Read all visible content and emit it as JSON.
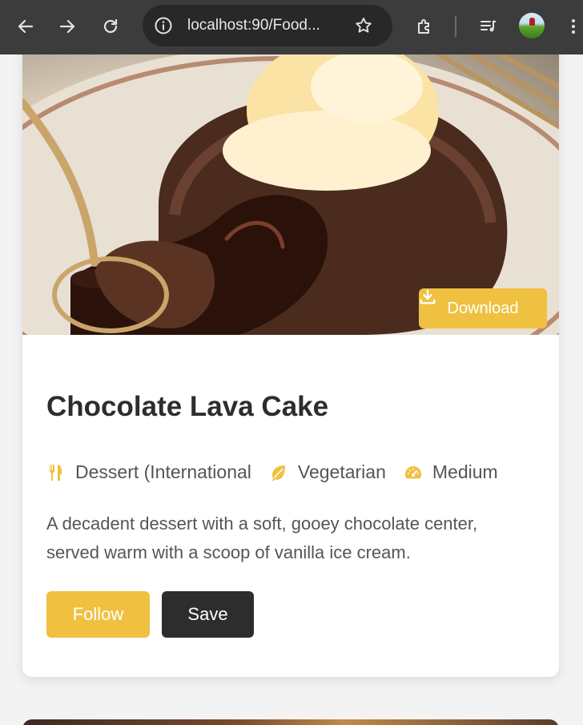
{
  "browser": {
    "url": "localhost:90/Food...",
    "icons": {
      "back": "back-arrow-icon",
      "forward": "forward-arrow-icon",
      "reload": "reload-icon",
      "site_info": "info-icon",
      "bookmark": "star-icon",
      "extensions": "puzzle-icon",
      "media": "media-queue-icon",
      "menu": "kebab-menu-icon"
    }
  },
  "recipe": {
    "download_label": "Download",
    "title": "Chocolate Lava Cake",
    "cuisine": "Dessert (International",
    "diet": "Vegetarian",
    "difficulty": "Medium",
    "description": "A decadent dessert with a soft, gooey chocolate center, served warm with a scoop of vanilla ice cream.",
    "follow_label": "Follow",
    "save_label": "Save"
  },
  "colors": {
    "accent": "#f0c040",
    "dark": "#2d2d2d",
    "text_muted": "#555555",
    "toolbar": "#3c3c3c"
  }
}
